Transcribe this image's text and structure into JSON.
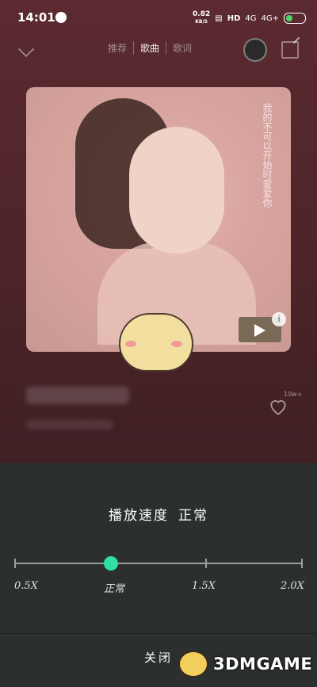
{
  "status_bar": {
    "time": "14:01",
    "net_speed_value": "0.82",
    "net_speed_unit": "KB/S",
    "hd": "HD",
    "signal1": "4G",
    "signal2": "4G+"
  },
  "nav": {
    "tabs": [
      "推荐",
      "歌曲",
      "歌词"
    ],
    "active_tab_index": 1
  },
  "cover": {
    "vertical_text": "我的不可以开始时爱爱你"
  },
  "likes_label": "10w+",
  "speed_sheet": {
    "title": "播放速度",
    "current": "正常",
    "options": [
      "0.5X",
      "正常",
      "1.5X",
      "2.0X"
    ],
    "selected_value": 1.0,
    "close_label": "关闭"
  },
  "watermark": {
    "text": "3DMGAME"
  },
  "colors": {
    "accent": "#2fe0a5",
    "sheet_bg": "#2c2f2f"
  }
}
